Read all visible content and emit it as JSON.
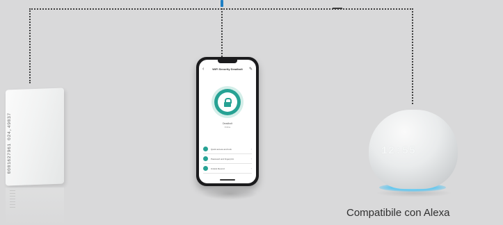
{
  "rfid_card": {
    "printed_number": "0001627961 024,49037"
  },
  "phone_app": {
    "header_title": "WiFi Security Deadbolt",
    "device_name": "Deadbolt",
    "device_status": "Online",
    "menu_items": [
      {
        "label": "Quick access and lock"
      },
      {
        "label": "Password and fingerprint"
      },
      {
        "label": "Unlock Record"
      }
    ],
    "accent_color": "#27a294"
  },
  "echo_dot": {
    "clock": "12:55",
    "ring_color": "#66c7ee"
  },
  "caption": {
    "text": "Compatibile con Alexa"
  },
  "connector": {
    "line_color": "#3c3c3c",
    "node_color": "#1e7fc4"
  }
}
